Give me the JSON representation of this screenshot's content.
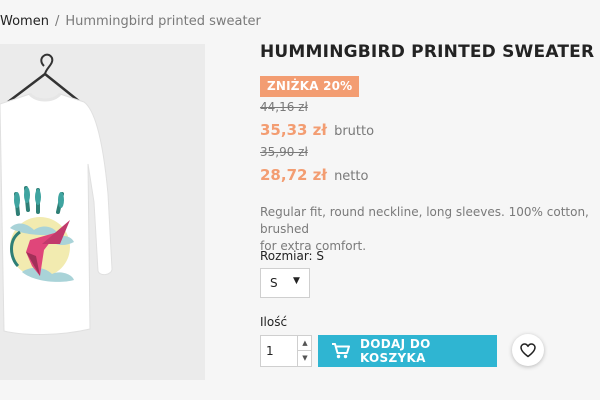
{
  "breadcrumb": {
    "items": [
      "Women",
      "Hummingbird printed sweater"
    ],
    "separator": "/"
  },
  "product": {
    "image": {
      "name": "hummingbird-sweater-image",
      "background": "#ebebeb"
    },
    "title": "HUMMINGBIRD PRINTED SWEATER",
    "discount_badge": "ZNIŻKA 20%",
    "gross": {
      "old_price": "44,16 zł",
      "price": "35,33 zł",
      "suffix": "brutto"
    },
    "net": {
      "old_price": "35,90 zł",
      "price": "28,72 zł",
      "suffix": "netto"
    },
    "description": "Regular fit, round neckline, long sleeves. 100% cotton, brushed\nfor extra comfort.",
    "size": {
      "label": "Rozmiar: S",
      "selected": "S"
    },
    "quantity": {
      "label": "Ilość",
      "value": "1"
    },
    "add_to_cart_label": "DODAJ DO KOSZYKA",
    "icons": {
      "cart": "cart-icon",
      "wishlist": "heart-icon",
      "caret": "caret-down-icon",
      "qty_up": "chevron-up-icon",
      "qty_down": "chevron-down-icon"
    },
    "colors": {
      "accent": "#2fb5d2",
      "price": "#f39d72",
      "badge": "#f39d72"
    }
  }
}
